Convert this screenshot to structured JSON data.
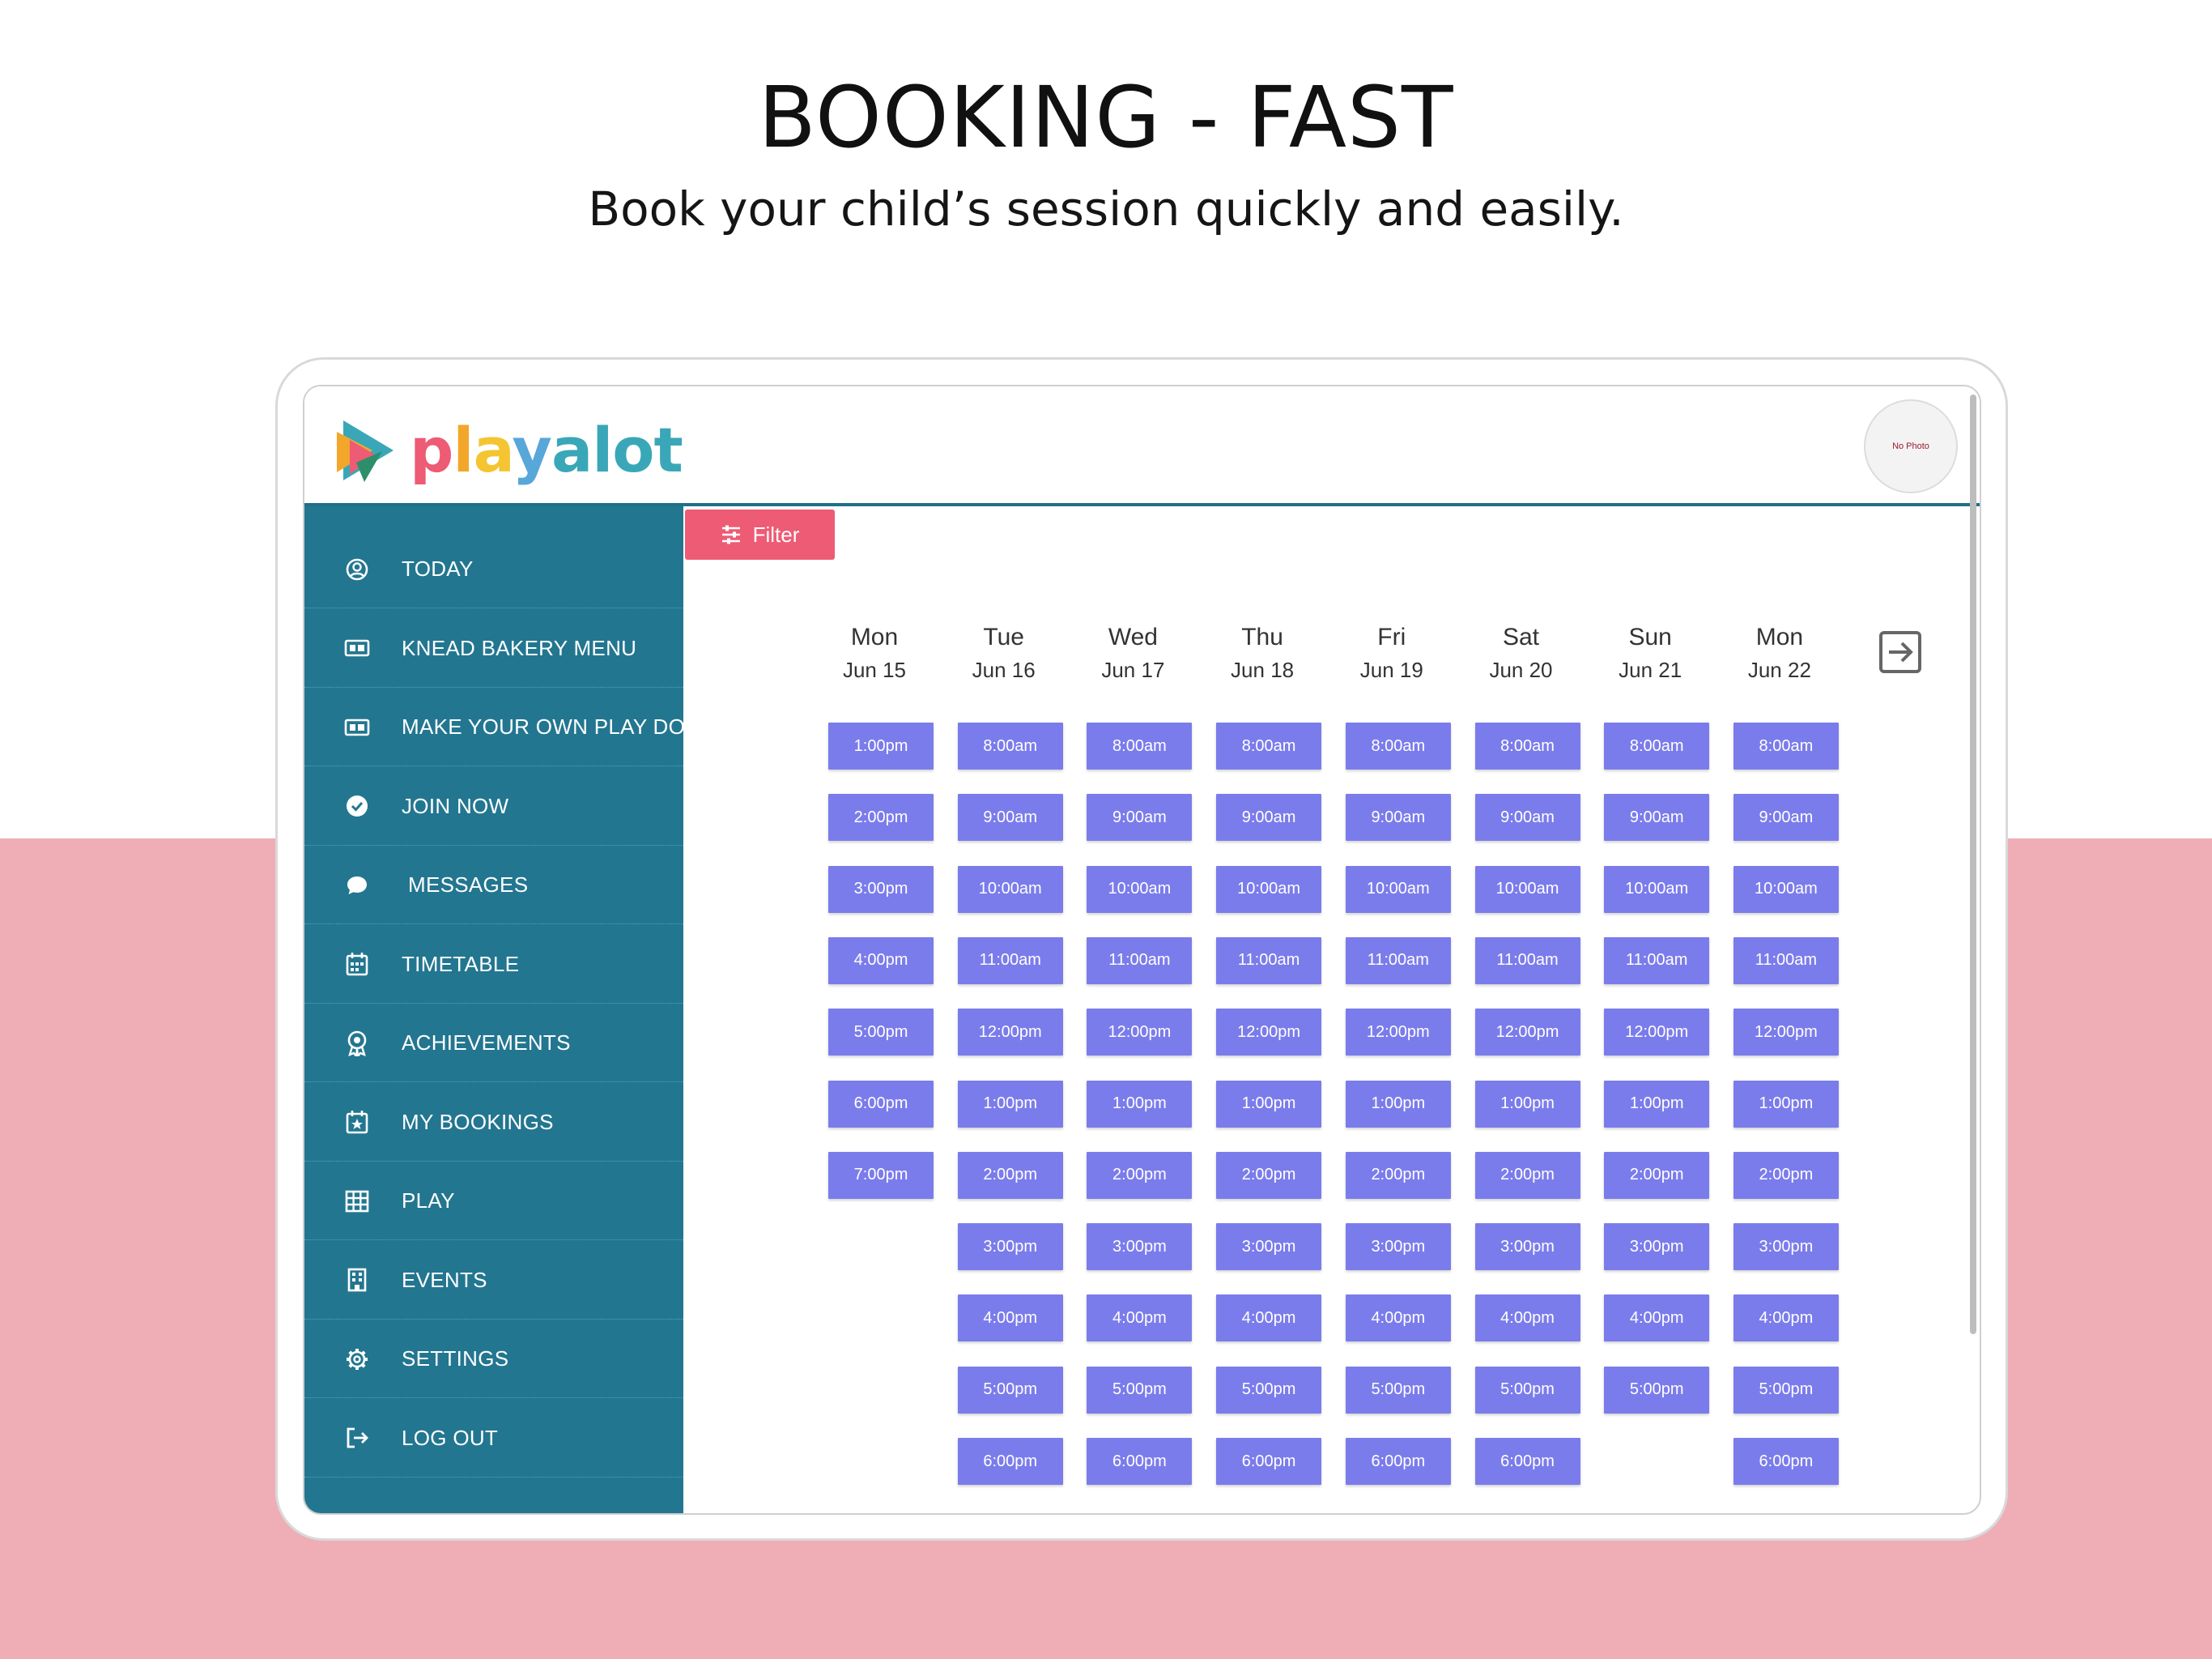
{
  "headline": "BOOKING - FAST",
  "subline": "Book your child’s session quickly and easily.",
  "brand": {
    "name_parts": [
      "p",
      "l",
      "a",
      "y",
      "alot"
    ],
    "colors": [
      "#ee5b74",
      "#f2a72b",
      "#f5c431",
      "#58a7d9",
      "#3aa7b8"
    ]
  },
  "avatar_text": "No Photo",
  "filter_label": "Filter",
  "nav": [
    {
      "label": "TODAY",
      "icon": "user-circle-icon"
    },
    {
      "label": "KNEAD BAKERY MENU",
      "icon": "menu-card-icon"
    },
    {
      "label": "MAKE YOUR OWN PLAY DOUGH",
      "icon": "menu-card-icon"
    },
    {
      "label": "JOIN NOW",
      "icon": "check-circle-icon"
    },
    {
      "label": "MESSAGES",
      "icon": "chat-bubble-icon"
    },
    {
      "label": "TIMETABLE",
      "icon": "calendar-icon"
    },
    {
      "label": "ACHIEVEMENTS",
      "icon": "award-icon"
    },
    {
      "label": "MY BOOKINGS",
      "icon": "calendar-star-icon"
    },
    {
      "label": "PLAY",
      "icon": "grid-icon"
    },
    {
      "label": "EVENTS",
      "icon": "building-icon"
    },
    {
      "label": "SETTINGS",
      "icon": "gear-icon"
    },
    {
      "label": "LOG OUT",
      "icon": "logout-icon"
    }
  ],
  "days": [
    {
      "name": "Mon",
      "date": "Jun 15",
      "slots": [
        "1:00pm",
        "2:00pm",
        "3:00pm",
        "4:00pm",
        "5:00pm",
        "6:00pm",
        "7:00pm"
      ]
    },
    {
      "name": "Tue",
      "date": "Jun 16",
      "slots": [
        "8:00am",
        "9:00am",
        "10:00am",
        "11:00am",
        "12:00pm",
        "1:00pm",
        "2:00pm",
        "3:00pm",
        "4:00pm",
        "5:00pm",
        "6:00pm"
      ]
    },
    {
      "name": "Wed",
      "date": "Jun 17",
      "slots": [
        "8:00am",
        "9:00am",
        "10:00am",
        "11:00am",
        "12:00pm",
        "1:00pm",
        "2:00pm",
        "3:00pm",
        "4:00pm",
        "5:00pm",
        "6:00pm"
      ]
    },
    {
      "name": "Thu",
      "date": "Jun 18",
      "slots": [
        "8:00am",
        "9:00am",
        "10:00am",
        "11:00am",
        "12:00pm",
        "1:00pm",
        "2:00pm",
        "3:00pm",
        "4:00pm",
        "5:00pm",
        "6:00pm"
      ]
    },
    {
      "name": "Fri",
      "date": "Jun 19",
      "slots": [
        "8:00am",
        "9:00am",
        "10:00am",
        "11:00am",
        "12:00pm",
        "1:00pm",
        "2:00pm",
        "3:00pm",
        "4:00pm",
        "5:00pm",
        "6:00pm"
      ]
    },
    {
      "name": "Sat",
      "date": "Jun 20",
      "slots": [
        "8:00am",
        "9:00am",
        "10:00am",
        "11:00am",
        "12:00pm",
        "1:00pm",
        "2:00pm",
        "3:00pm",
        "4:00pm",
        "5:00pm",
        "6:00pm"
      ]
    },
    {
      "name": "Sun",
      "date": "Jun 21",
      "slots": [
        "8:00am",
        "9:00am",
        "10:00am",
        "11:00am",
        "12:00pm",
        "1:00pm",
        "2:00pm",
        "3:00pm",
        "4:00pm",
        "5:00pm"
      ]
    },
    {
      "name": "Mon",
      "date": "Jun 22",
      "slots": [
        "8:00am",
        "9:00am",
        "10:00am",
        "11:00am",
        "12:00pm",
        "1:00pm",
        "2:00pm",
        "3:00pm",
        "4:00pm",
        "5:00pm",
        "6:00pm"
      ]
    }
  ],
  "colors": {
    "sidebar": "#237690",
    "slot": "#7b7ceb",
    "filter": "#ee5b74",
    "band": "#efadb5"
  }
}
